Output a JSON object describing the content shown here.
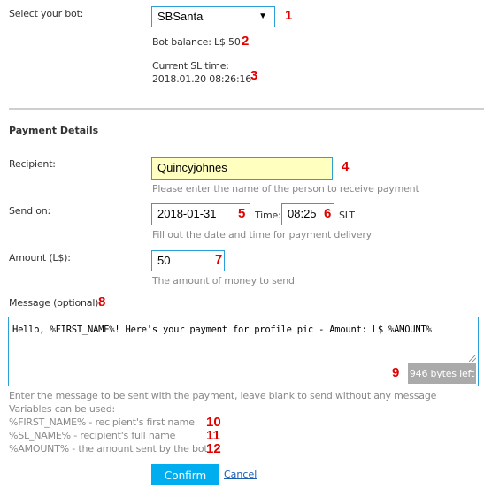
{
  "bot": {
    "label": "Select your bot:",
    "selected": "SBSanta",
    "arrow_icon": "▼",
    "balance_text": "Bot balance: L$ 50",
    "sl_time_label": "Current SL time:",
    "sl_time_value": "2018.01.20 08:26:16"
  },
  "payment": {
    "section_title": "Payment Details",
    "recipient": {
      "label": "Recipient:",
      "value": "Quincyjohnes",
      "hint": "Please enter the name of the person to receive payment"
    },
    "send_on": {
      "label": "Send on:",
      "date_value": "2018-01-31",
      "time_label": "Time:",
      "time_value": "08:25",
      "time_suffix": "SLT",
      "hint": "Fill out the date and time for payment delivery"
    },
    "amount": {
      "label": "Amount (L$):",
      "value": "50",
      "hint": "The amount of money to send"
    },
    "message": {
      "label": "Message (optional):",
      "value": "Hello, %FIRST_NAME%! Here's your payment for profile pic - Amount: L$ %AMOUNT%",
      "bytes_left": "946 bytes left",
      "hint": "Enter the message to be sent with the payment, leave blank to send without any message",
      "variables_title": "Variables can be used:",
      "variables": [
        "%FIRST_NAME% - recipient's first name",
        "%SL_NAME% - recipient's full name",
        "%AMOUNT% - the amount sent by the bot"
      ]
    }
  },
  "actions": {
    "confirm_label": "Confirm",
    "cancel_label": "Cancel"
  },
  "annotations": [
    "1",
    "2",
    "3",
    "4",
    "5",
    "6",
    "7",
    "8",
    "9",
    "10",
    "11",
    "12"
  ],
  "colors": {
    "accent": "#00aeef",
    "field_border": "#2a9fd8",
    "recipient_bg": "#ffffc0",
    "annotation": "#e00000",
    "badge_bg": "#aaaaaa"
  }
}
